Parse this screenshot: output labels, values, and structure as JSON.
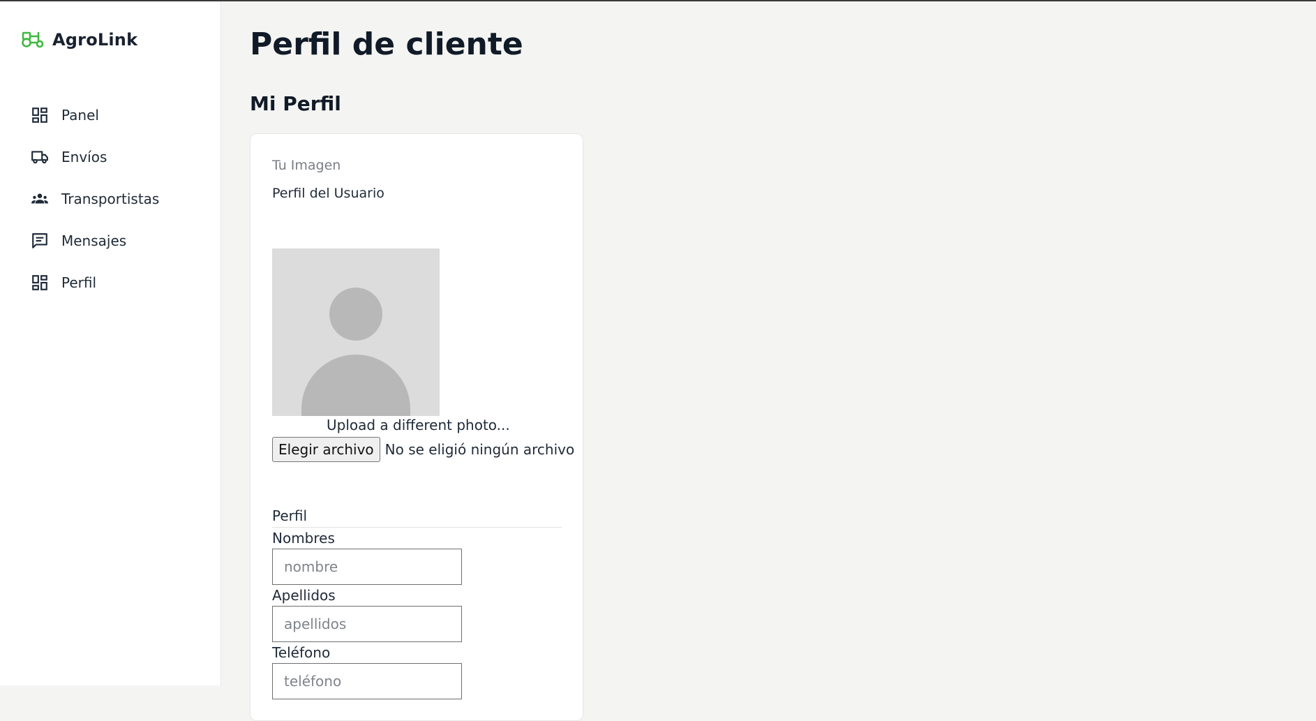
{
  "app": {
    "brand": "AgroLink",
    "accent_color": "#3fb93f"
  },
  "sidebar": {
    "items": [
      {
        "label": "Panel",
        "icon": "dashboard-icon"
      },
      {
        "label": "Envíos",
        "icon": "truck-icon"
      },
      {
        "label": "Transportistas",
        "icon": "group-icon"
      },
      {
        "label": "Mensajes",
        "icon": "message-icon"
      },
      {
        "label": "Perfil",
        "icon": "dashboard-icon"
      }
    ]
  },
  "main": {
    "title": "Perfil de cliente",
    "section_title": "Mi Perfil",
    "card": {
      "image_heading": "Tu Imagen",
      "image_subheading": "Perfil del Usuario",
      "upload_hint": "Upload a different photo...",
      "file_button": "Elegir archivo",
      "file_status": "No se eligió ningún archivo",
      "profile_heading": "Perfil",
      "fields": [
        {
          "label": "Nombres",
          "placeholder": "nombre",
          "value": ""
        },
        {
          "label": "Apellidos",
          "placeholder": "apellidos",
          "value": ""
        },
        {
          "label": "Teléfono",
          "placeholder": "teléfono",
          "value": ""
        }
      ]
    }
  }
}
